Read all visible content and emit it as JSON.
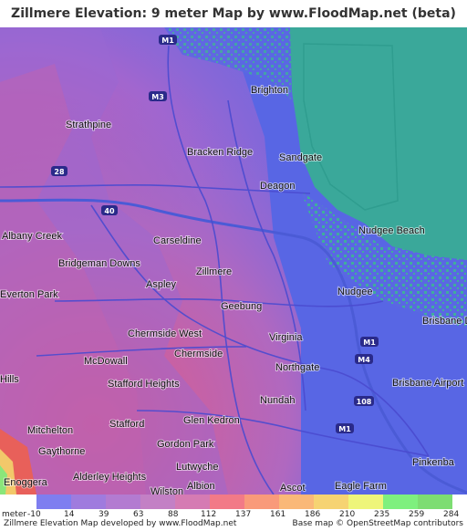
{
  "title": "Zillmere Elevation: 9 meter Map by www.FloodMap.net (beta)",
  "map": {
    "place_labels": [
      {
        "text": "Brighton"
      },
      {
        "text": "Strathpine"
      },
      {
        "text": "Bracken Ridge"
      },
      {
        "text": "Sandgate"
      },
      {
        "text": "Deagon"
      },
      {
        "text": "Albany Creek"
      },
      {
        "text": "Carseldine"
      },
      {
        "text": "Nudgee Beach"
      },
      {
        "text": "Bridgeman Downs"
      },
      {
        "text": "Zillmere"
      },
      {
        "text": "Aspley"
      },
      {
        "text": "Nudgee"
      },
      {
        "text": "Geebung"
      },
      {
        "text": "Chermside West"
      },
      {
        "text": "Virginia"
      },
      {
        "text": "Chermside"
      },
      {
        "text": "McDowall"
      },
      {
        "text": "Northgate"
      },
      {
        "text": "Stafford Heights"
      },
      {
        "text": "Nundah"
      },
      {
        "text": "Glen Kedron"
      },
      {
        "text": "Stafford"
      },
      {
        "text": "Mitchelton"
      },
      {
        "text": "Gordon Park"
      },
      {
        "text": "Gaythorne"
      },
      {
        "text": "Lutwyche"
      },
      {
        "text": "Alderley Heights"
      },
      {
        "text": "Albion"
      },
      {
        "text": "Ascot"
      },
      {
        "text": "Eagle Farm"
      },
      {
        "text": "Pinkenba"
      },
      {
        "text": "Enoggera"
      },
      {
        "text": "Brisbane Domestic Airport"
      },
      {
        "text": "Brisbane Airport"
      },
      {
        "text": "Wilston"
      },
      {
        "text": "Everton Park"
      },
      {
        "text": "Hills"
      }
    ],
    "road_shields": [
      "M1",
      "M3",
      "28",
      "40",
      "M1",
      "M4",
      "108",
      "M1"
    ],
    "colors": {
      "sea": "#3aa89a",
      "low": "#5d67e0",
      "mid": "#8a6ad8",
      "high": "#c068b0",
      "peak": "#e05a80"
    }
  },
  "legend": {
    "unit": "meter",
    "ticks": [
      "-10",
      "14",
      "39",
      "63",
      "88",
      "112",
      "137",
      "161",
      "186",
      "210",
      "235",
      "259",
      "284"
    ],
    "colors": [
      "#72d2c9",
      "#7e7ef0",
      "#9f7bde",
      "#b37bd1",
      "#c380c5",
      "#d57bb3",
      "#f27a87",
      "#f99a7a",
      "#fab878",
      "#f6d372",
      "#eef57a",
      "#7ef07e",
      "#7ddd72"
    ]
  },
  "footer": {
    "left": "Zillmere Elevation Map developed by www.FloodMap.net",
    "right": "Base map © OpenStreetMap contributors"
  }
}
